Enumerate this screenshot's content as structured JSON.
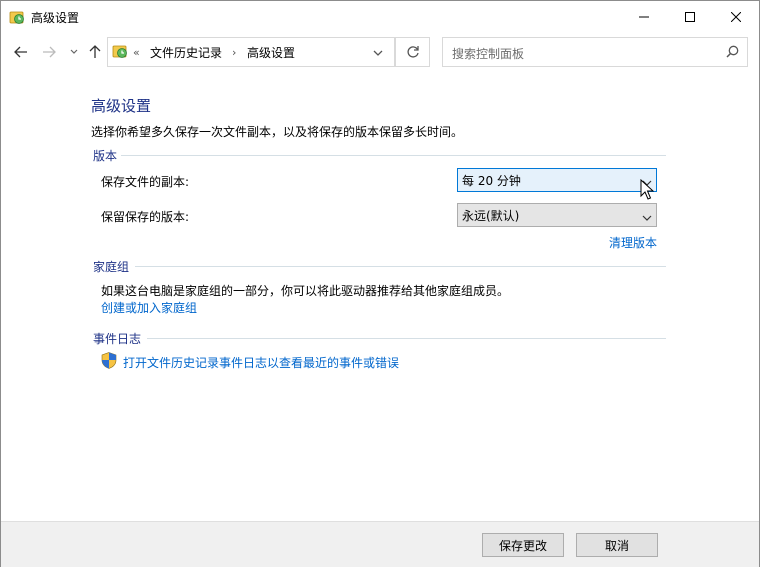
{
  "window": {
    "title": "高级设置"
  },
  "nav": {
    "back": "back-arrow",
    "forward": "forward-arrow",
    "recent": "chevron-down",
    "up": "up-arrow"
  },
  "address": {
    "overflow": "«",
    "crumbs": [
      "文件历史记录",
      "高级设置"
    ],
    "separator": "›"
  },
  "search": {
    "placeholder": "搜索控制面板"
  },
  "page": {
    "title": "高级设置",
    "description": "选择你希望多久保存一次文件副本，以及将保存的版本保留多长时间。"
  },
  "versions": {
    "header": "版本",
    "save_copies_label": "保存文件的副本:",
    "save_copies_value": "每 20 分钟",
    "keep_versions_label": "保留保存的版本:",
    "keep_versions_value": "永远(默认)",
    "cleanup_link": "清理版本"
  },
  "homegroup": {
    "header": "家庭组",
    "text": "如果这台电脑是家庭组的一部分，你可以将此驱动器推荐给其他家庭组成员。",
    "link": "创建或加入家庭组"
  },
  "eventlog": {
    "header": "事件日志",
    "link": "打开文件历史记录事件日志以查看最近的事件或错误"
  },
  "footer": {
    "save": "保存更改",
    "cancel": "取消"
  },
  "colors": {
    "heading": "#1e3287",
    "link": "#0066cc",
    "accent": "#0078d7"
  }
}
